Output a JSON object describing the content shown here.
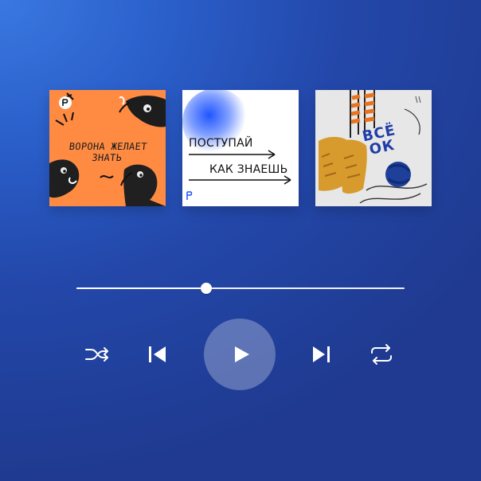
{
  "colors": {
    "background_top_left": "#3a78e0",
    "background_bottom_right": "#1f3a90",
    "card1_bg": "#ff8b43",
    "card2_accent": "#1f55ff",
    "card3_title": "#1f3da8"
  },
  "covers": [
    {
      "title": "ВОРОНА ЖЕЛАЕТ ЗНАТЬ"
    },
    {
      "line1": "ПОСТУПАЙ",
      "line2": "КАК ЗНАЕШЬ"
    },
    {
      "title": "ВСЁ ОК"
    }
  ],
  "player": {
    "progress_fraction": 0.396
  },
  "icons": {
    "shuffle": "shuffle-icon",
    "previous": "previous-icon",
    "play": "play-icon",
    "next": "next-icon",
    "repeat": "repeat-icon"
  }
}
